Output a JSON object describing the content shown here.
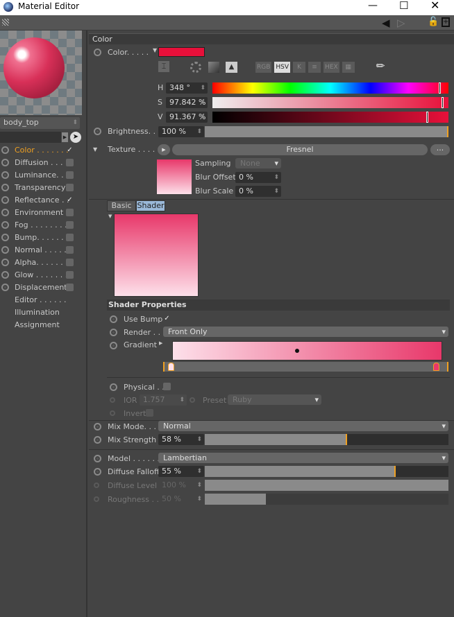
{
  "window": {
    "title": "Material Editor"
  },
  "material": {
    "name": "body_top"
  },
  "channels": [
    {
      "label": "Color . . . . . . .",
      "checked": true,
      "active": true
    },
    {
      "label": "Diffusion . . . . .",
      "checked": false
    },
    {
      "label": "Luminance. . . .",
      "checked": false
    },
    {
      "label": "Transparency",
      "checked": false
    },
    {
      "label": "Reflectance . .",
      "checked": true
    },
    {
      "label": "Environment",
      "checked": false
    },
    {
      "label": "Fog . . . . . . . .",
      "checked": false
    },
    {
      "label": "Bump. . . . . . .",
      "checked": false
    },
    {
      "label": "Normal . . . . .",
      "checked": false
    },
    {
      "label": "Alpha. . . . . . .",
      "checked": false
    },
    {
      "label": "Glow . . . . . . .",
      "checked": false
    },
    {
      "label": "Displacement",
      "checked": false
    },
    {
      "label": "Editor . . . . . .",
      "checked": null
    },
    {
      "label": "Illumination",
      "checked": null
    },
    {
      "label": "Assignment",
      "checked": null
    }
  ],
  "color": {
    "section": "Color",
    "label": "Color. . . . .",
    "swatch": "#e8103a",
    "modes": [
      "RGB",
      "HSV",
      "K",
      "≡",
      "HEX",
      "▦"
    ],
    "h": {
      "label": "H",
      "value": "348 °"
    },
    "s": {
      "label": "S",
      "value": "97.842 %"
    },
    "v": {
      "label": "V",
      "value": "91.367 %"
    },
    "brightness": {
      "label": "Brightness. . .",
      "value": "100 %",
      "percent": 100
    },
    "texture": {
      "label": "Texture . . . . .",
      "shader": "Fresnel",
      "more": "..."
    },
    "sampling": {
      "label": "Sampling",
      "value": "None"
    },
    "blur_offset": {
      "label": "Blur Offset",
      "value": "0 %"
    },
    "blur_scale": {
      "label": "Blur Scale",
      "value": "0 %"
    }
  },
  "tabs": {
    "basic": "Basic",
    "shader": "Shader",
    "active": "shader"
  },
  "shader_props": {
    "title": "Shader Properties",
    "use_bump": {
      "label": "Use Bump",
      "checked": true
    },
    "render": {
      "label": "Render . .",
      "value": "Front Only"
    },
    "gradient": {
      "label": "Gradient",
      "start": "#fde0ea",
      "end": "#e8386a"
    },
    "physical": {
      "label": "Physical . .",
      "checked": false
    },
    "ior": {
      "label": "IOR",
      "value": "1.757"
    },
    "preset": {
      "label": "Preset",
      "value": "Ruby"
    },
    "invert": {
      "label": "Invert",
      "checked": false
    }
  },
  "mix": {
    "mode": {
      "label": "Mix Mode. . .",
      "value": "Normal"
    },
    "strength": {
      "label": "Mix Strength",
      "value": "58 %",
      "percent": 58
    }
  },
  "model": {
    "model": {
      "label": "Model . . . . . .",
      "value": "Lambertian"
    },
    "falloff": {
      "label": "Diffuse Falloff",
      "value": "55 %",
      "percent": 78
    },
    "level": {
      "label": "Diffuse Level",
      "value": "100 %",
      "percent": 100
    },
    "roughness": {
      "label": "Roughness . .",
      "value": "50 %",
      "percent": 25
    }
  },
  "colors": {
    "accent": "#f0a020",
    "panel": "#444444"
  }
}
